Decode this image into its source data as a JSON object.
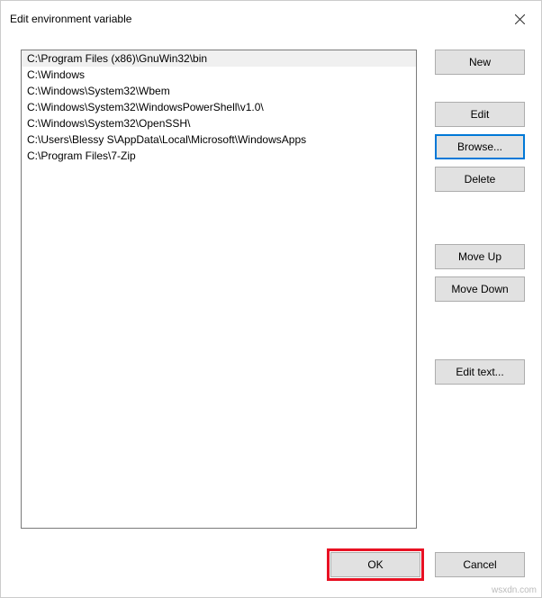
{
  "window": {
    "title": "Edit environment variable"
  },
  "list": {
    "items": [
      "C:\\Program Files (x86)\\GnuWin32\\bin",
      "C:\\Windows",
      "C:\\Windows\\System32\\Wbem",
      "C:\\Windows\\System32\\WindowsPowerShell\\v1.0\\",
      "C:\\Windows\\System32\\OpenSSH\\",
      "C:\\Users\\Blessy S\\AppData\\Local\\Microsoft\\WindowsApps",
      "C:\\Program Files\\7-Zip"
    ],
    "selected_index": 0
  },
  "buttons": {
    "new": "New",
    "edit": "Edit",
    "browse": "Browse...",
    "delete": "Delete",
    "move_up": "Move Up",
    "move_down": "Move Down",
    "edit_text": "Edit text...",
    "ok": "OK",
    "cancel": "Cancel"
  },
  "watermark": "wsxdn.com"
}
